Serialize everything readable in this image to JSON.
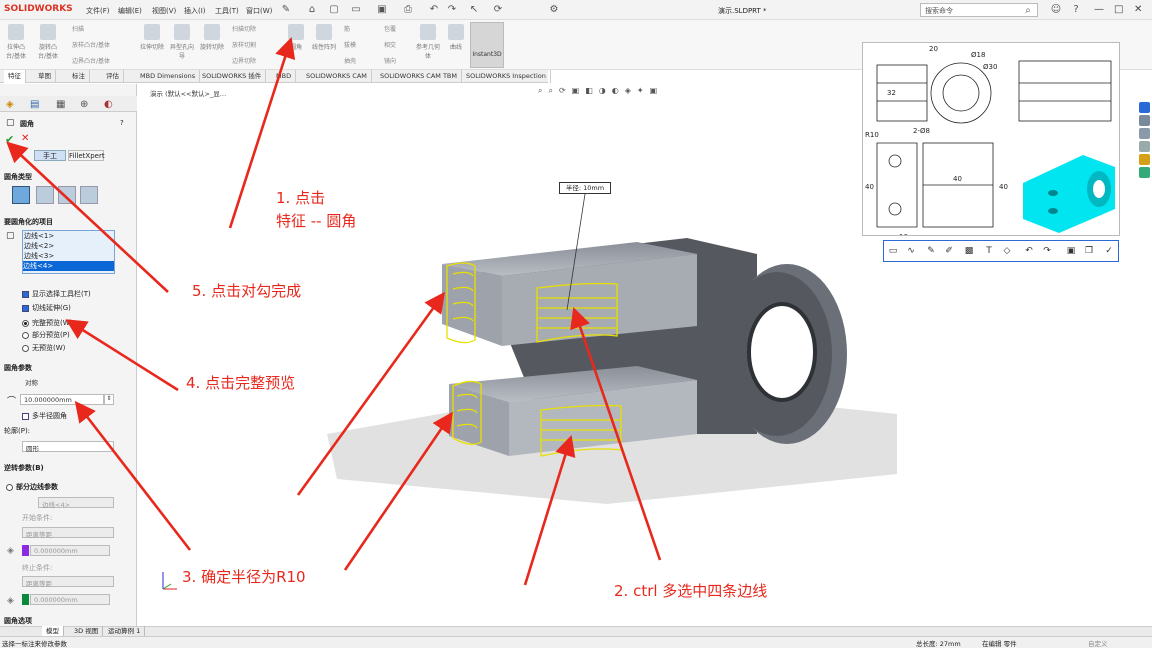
{
  "app": {
    "logo": "SOLIDWORKS",
    "menus": [
      "文件(F)",
      "编辑(E)",
      "视图(V)",
      "插入(I)",
      "工具(T)",
      "窗口(W)"
    ],
    "doc_title": "演示.SLDPRT *",
    "search_placeholder": "搜索命令",
    "window_controls": [
      "—",
      "□",
      "✕"
    ]
  },
  "ribbon": {
    "buttons": [
      "拉伸凸台/基体",
      "旋转凸台/基体",
      "拉伸切除",
      "异型孔向导",
      "旋转切除",
      "圆角",
      "线性阵列",
      "筋",
      "包覆",
      "参考几何体",
      "曲线"
    ],
    "small_items": [
      "扫描",
      "放样凸台/基体",
      "边界凸台/基体",
      "扫描切除",
      "放样切割",
      "边界切除",
      "拔模",
      "抽壳",
      "相交",
      "镜向"
    ],
    "instant3d": "Instant3D"
  },
  "command_tabs": [
    "特征",
    "草图",
    "标注",
    "评估",
    "MBD Dimensions",
    "SOLIDWORKS 插件",
    "MBD",
    "SOLIDWORKS CAM",
    "SOLIDWORKS CAM TBM",
    "SOLIDWORKS Inspection"
  ],
  "panel": {
    "title": "圆角",
    "help": "?",
    "ok": "✔",
    "cancel": "✕",
    "mode_tabs": [
      "手工",
      "FilletXpert"
    ],
    "fillet_type_label": "圆角类型",
    "items_label": "要圆角化的项目",
    "edges": [
      "边线<1>",
      "边线<2>",
      "边线<3>",
      "边线<4>"
    ],
    "options": [
      {
        "label": "显示选择工具栏(T)",
        "checked": true
      },
      {
        "label": "切线延伸(G)",
        "checked": true
      }
    ],
    "preview": [
      {
        "label": "完整预览(W)",
        "selected": true
      },
      {
        "label": "部分预览(P)",
        "selected": false
      },
      {
        "label": "无预览(W)",
        "selected": false
      }
    ],
    "params_label": "圆角参数",
    "symmetric": "对称",
    "radius": "10.000000mm",
    "multi_radius": "多半径圆角",
    "profile_label": "轮廓(P):",
    "profile": "圆形",
    "setback_label": "逆转参数(B)",
    "partial_label": "部分边线参数",
    "partial_edge": "边线<4>",
    "start_cond": "开始条件:",
    "end_cond": "终止条件:",
    "distance_equal": "距离等距",
    "zero_value": "0.000000mm",
    "fillet_options": "圆角选项"
  },
  "bottom_tabs": [
    "模型",
    "3D 视图",
    "运动算例 1"
  ],
  "status": {
    "left": "选择一标注来修改参数",
    "length": "总长度: 27mm",
    "mode": "在编辑 零件",
    "units": "自定义"
  },
  "viewport": {
    "breadcrumb": "演示 (默认<<默认>_显…",
    "dim_tag": "半径: 10mm"
  },
  "annotations": [
    {
      "text": "1. 点击"
    },
    {
      "text": "特征  --  圆角"
    },
    {
      "text": "2. ctrl 多选中四条边线"
    },
    {
      "text": "3. 确定半径为R10"
    },
    {
      "text": "4. 点击完整预览"
    },
    {
      "text": "5. 点击对勾完成"
    }
  ],
  "drawing_dims": [
    "20",
    "Ø18",
    "Ø30",
    "32",
    "R10",
    "2-Ø8",
    "40",
    "10",
    "40",
    "40"
  ],
  "colors": {
    "annotation": "#e8281c",
    "selection": "#e8e000",
    "accent": "#2a6ad8",
    "part": "#6a6f78",
    "thumb": "#00e5ef"
  }
}
